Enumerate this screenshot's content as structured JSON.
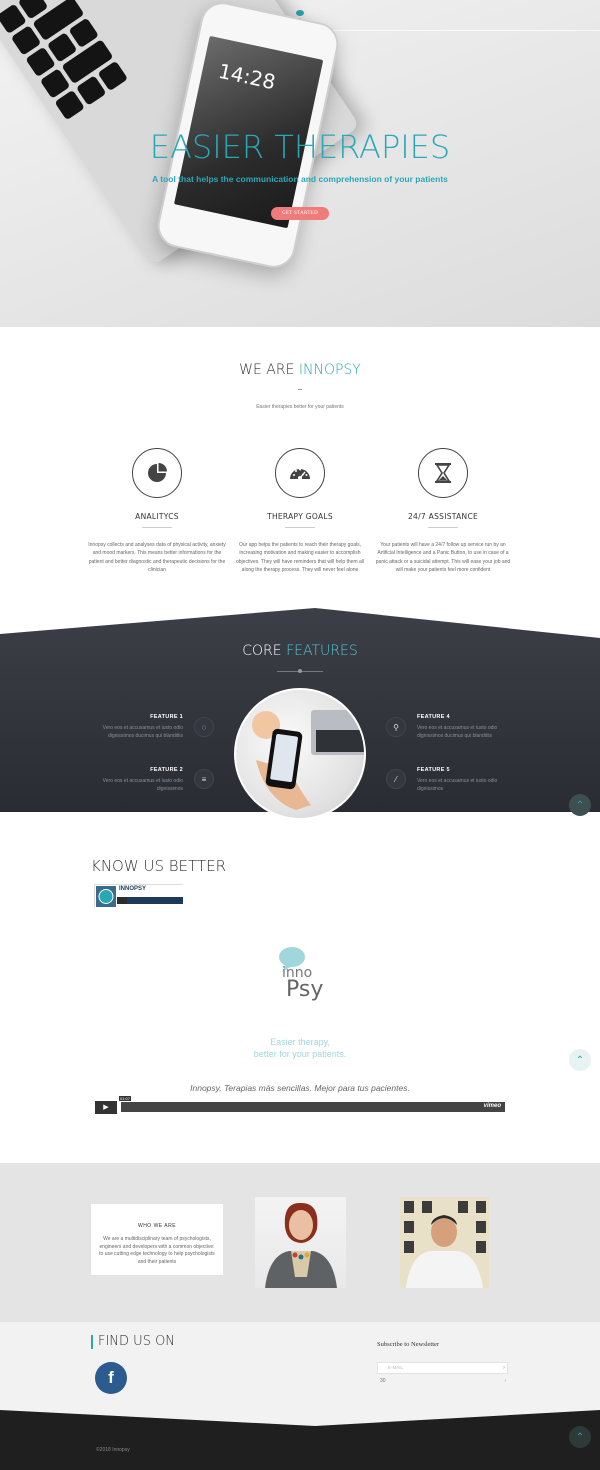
{
  "hero": {
    "title": "EASIER THERAPIES",
    "subtitle": "A tool that helps the communication and comprehension of your patients",
    "cta_label": "GET STARTED",
    "phone_time": "14:28"
  },
  "about": {
    "title_plain": "WE ARE ",
    "title_accent": "INNOPSY",
    "subtitle": "Easier therapies better for your patients",
    "features": [
      {
        "icon": "pie-chart-icon",
        "title": "ANALITYCS",
        "desc": "Innopsy collects and analyses data of physical activity, anxiety and mood markers. This means better informations for the patient and better diagnostic and therapeutic decisions for the clinician"
      },
      {
        "icon": "gauge-icon",
        "title": "THERAPY GOALS",
        "desc": "Our app helps the patients to reach their therapy goals, increasing motivation and making easier to accomplish objectives. They will have reminders that will help them all along the therapy process. They will never feel alone"
      },
      {
        "icon": "hourglass-icon",
        "title": "24/7 ASSISTANCE",
        "desc": "Your patients will have a 24/7 follow up service run by an Artificial Intelligence and a Panic Button, to use in case of a panic attack or a suicidal attempt. This will ease your job and will make your patients feel more confident"
      }
    ]
  },
  "core": {
    "title_plain": "CORE ",
    "title_accent": "FEATURES",
    "features": [
      {
        "title": "FEATURE 1",
        "desc": "Vero eos et accusamus et iusto odio dignissimos ducimus qui blanditiis",
        "icon": "spinner-icon"
      },
      {
        "title": "FEATURE 2",
        "desc": "Vero eos et accusamus et iusto odio dignissimos",
        "icon": "sliders-icon"
      },
      {
        "title": "FEATURE 4",
        "desc": "Vero eos et accusamus et iusto odio dignissimos ducimus qui blanditiis",
        "icon": "search-icon"
      },
      {
        "title": "FEATURE 5",
        "desc": "Vero eos et accusamus et iusto odio dignissimos",
        "icon": "magic-wand-icon"
      }
    ]
  },
  "know": {
    "title": "KNOW US BETTER",
    "thumb_label": "INNOPSY",
    "logo_line1": "inno",
    "logo_line2": "Psy",
    "tagline1": "Easier therapy,",
    "tagline2": "better for your patients.",
    "caption": "Innopsy, Terapias más sencillas. Mejor para tus pacientes.",
    "video_time": "01:07",
    "video_brand": "vimeo"
  },
  "who": {
    "title": "WHO WE ARE",
    "desc": "We are a multidisciplinary team of psychologists, engineers and developers with a common objective: to use cutting edge technology to help psychologists and their patients"
  },
  "find": {
    "title": "FIND US ON",
    "fb_letter": "f",
    "newsletter_title": "Subscribe to Newsletter",
    "email_placeholder": "E-MAIL",
    "row2": "30"
  },
  "footer": {
    "copyright": "©2018 Innopsy"
  },
  "colors": {
    "accent": "#2aa7b5",
    "cta": "#f07b7b",
    "dark": "#2f3138",
    "facebook": "#2b5b8f"
  }
}
